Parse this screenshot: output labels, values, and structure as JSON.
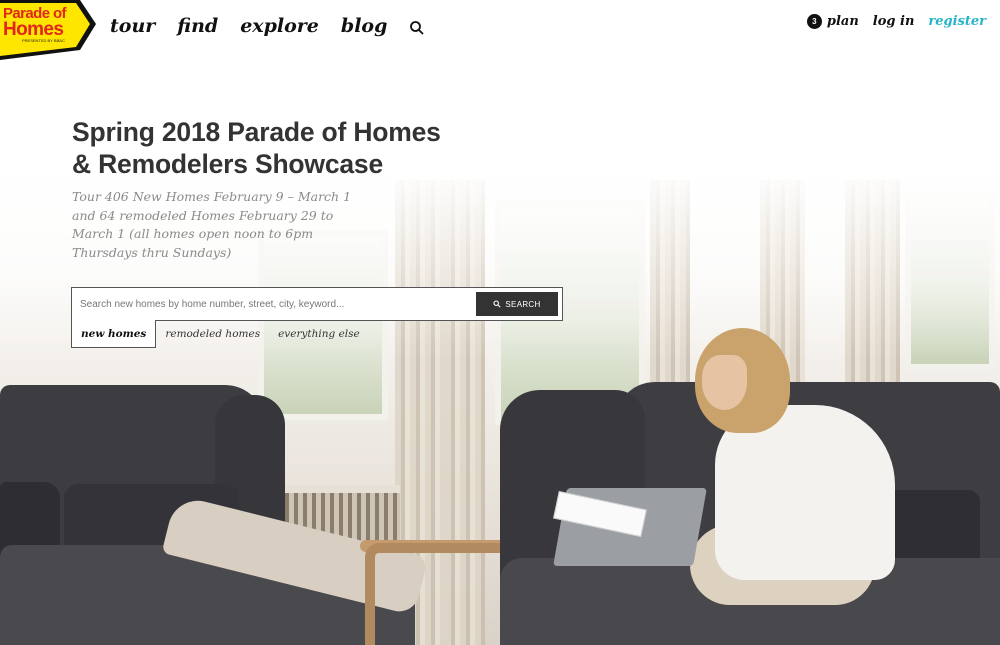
{
  "logo": {
    "line1": "Parade of",
    "line2": "Homes",
    "tagline": "PRESENTED BY BBAC",
    "colors": {
      "background": "#ffe600",
      "text": "#e1261c",
      "edge": "#111111"
    }
  },
  "nav": {
    "items": [
      {
        "label": "tour"
      },
      {
        "label": "find"
      },
      {
        "label": "explore"
      },
      {
        "label": "blog"
      }
    ],
    "search_icon": "search-icon"
  },
  "user_nav": {
    "plan_count": "3",
    "plan_label": "plan",
    "login_label": "log in",
    "register_label": "register",
    "register_color": "#27b3c8"
  },
  "hero": {
    "title_line1": "Spring 2018 Parade of Homes",
    "title_line2": "& Remodelers Showcase",
    "subtitle": "Tour 406 New Homes February 9 – March 1 and 64 remodeled Homes February 29 to March 1 (all homes open noon to 6pm Thursdays thru Sundays)"
  },
  "search": {
    "placeholder": "Search new homes by home number, street, city, keyword...",
    "value": "",
    "button_label": "SEARCH",
    "button_icon": "search-icon"
  },
  "tabs": [
    {
      "label": "new homes",
      "active": true
    },
    {
      "label": "remodeled homes",
      "active": false
    },
    {
      "label": "everything else",
      "active": false
    }
  ]
}
